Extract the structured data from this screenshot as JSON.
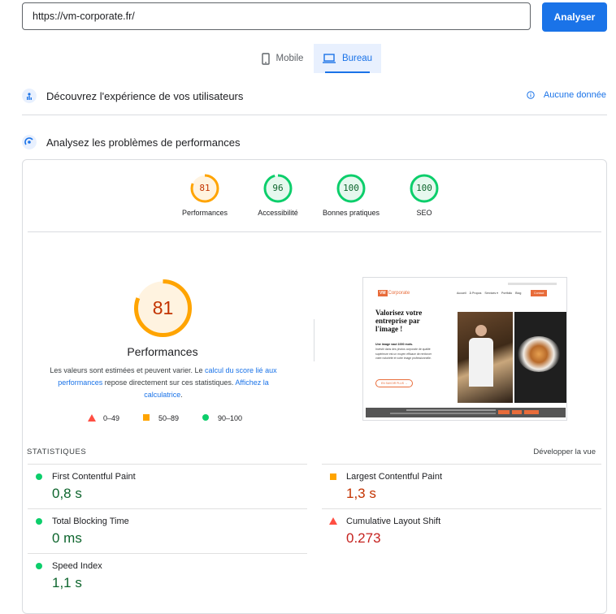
{
  "url_bar": {
    "value": "https://vm-corporate.fr/",
    "analyze_label": "Analyser"
  },
  "device_tabs": {
    "mobile": "Mobile",
    "desktop": "Bureau"
  },
  "field_section": {
    "title": "Découvrez l'expérience de vos utilisateurs",
    "no_data": "Aucune donnée"
  },
  "lab_section": {
    "title": "Analysez les problèmes de performances"
  },
  "scores": [
    {
      "value": "81",
      "label": "Performances",
      "color": "#ffa400"
    },
    {
      "value": "96",
      "label": "Accessibilité",
      "color": "#0cce6b"
    },
    {
      "value": "100",
      "label": "Bonnes pratiques",
      "color": "#0cce6b"
    },
    {
      "value": "100",
      "label": "SEO",
      "color": "#0cce6b"
    }
  ],
  "main_gauge": {
    "value": "81",
    "fraction": 0.81,
    "label": "Performances",
    "desc_1": "Les valeurs sont estimées et peuvent varier. Le ",
    "desc_link_1": "calcul du score lié aux performances",
    "desc_2": " repose directement sur ces statistiques. ",
    "desc_link_2": "Affichez la calculatrice",
    "desc_3": "."
  },
  "legend": {
    "bad": "0–49",
    "average": "50–89",
    "good": "90–100"
  },
  "stats": {
    "header": "STATISTIQUES",
    "expand": "Développer la vue",
    "items": [
      {
        "name": "First Contentful Paint",
        "value": "0,8 s",
        "status": "good"
      },
      {
        "name": "Largest Contentful Paint",
        "value": "1,3 s",
        "status": "average"
      },
      {
        "name": "Total Blocking Time",
        "value": "0 ms",
        "status": "good"
      },
      {
        "name": "Cumulative Layout Shift",
        "value": "0.273",
        "status": "bad"
      },
      {
        "name": "Speed Index",
        "value": "1,1 s",
        "status": "good"
      }
    ]
  },
  "screenshot": {
    "logo_vm": "VM",
    "logo_text": "Corporate",
    "nav": [
      "Accueil",
      "À Propos",
      "Services ▾",
      "Portfolio",
      "Blog"
    ],
    "contact": "Contact",
    "headline": "Valorisez votre entreprise par l'image !",
    "subhead": "Une image vaut 1000 mots.",
    "body": "Investir dans des photos corporate de qualité supérieure est un moyen efficace de renforcer votre notoriété et votre image professionnelle.",
    "cta": "EN SAVOIR PLUS →"
  },
  "colors": {
    "accent": "#1a73e8",
    "good": "#0cce6b",
    "average": "#ffa400",
    "bad": "#ff4e42"
  }
}
